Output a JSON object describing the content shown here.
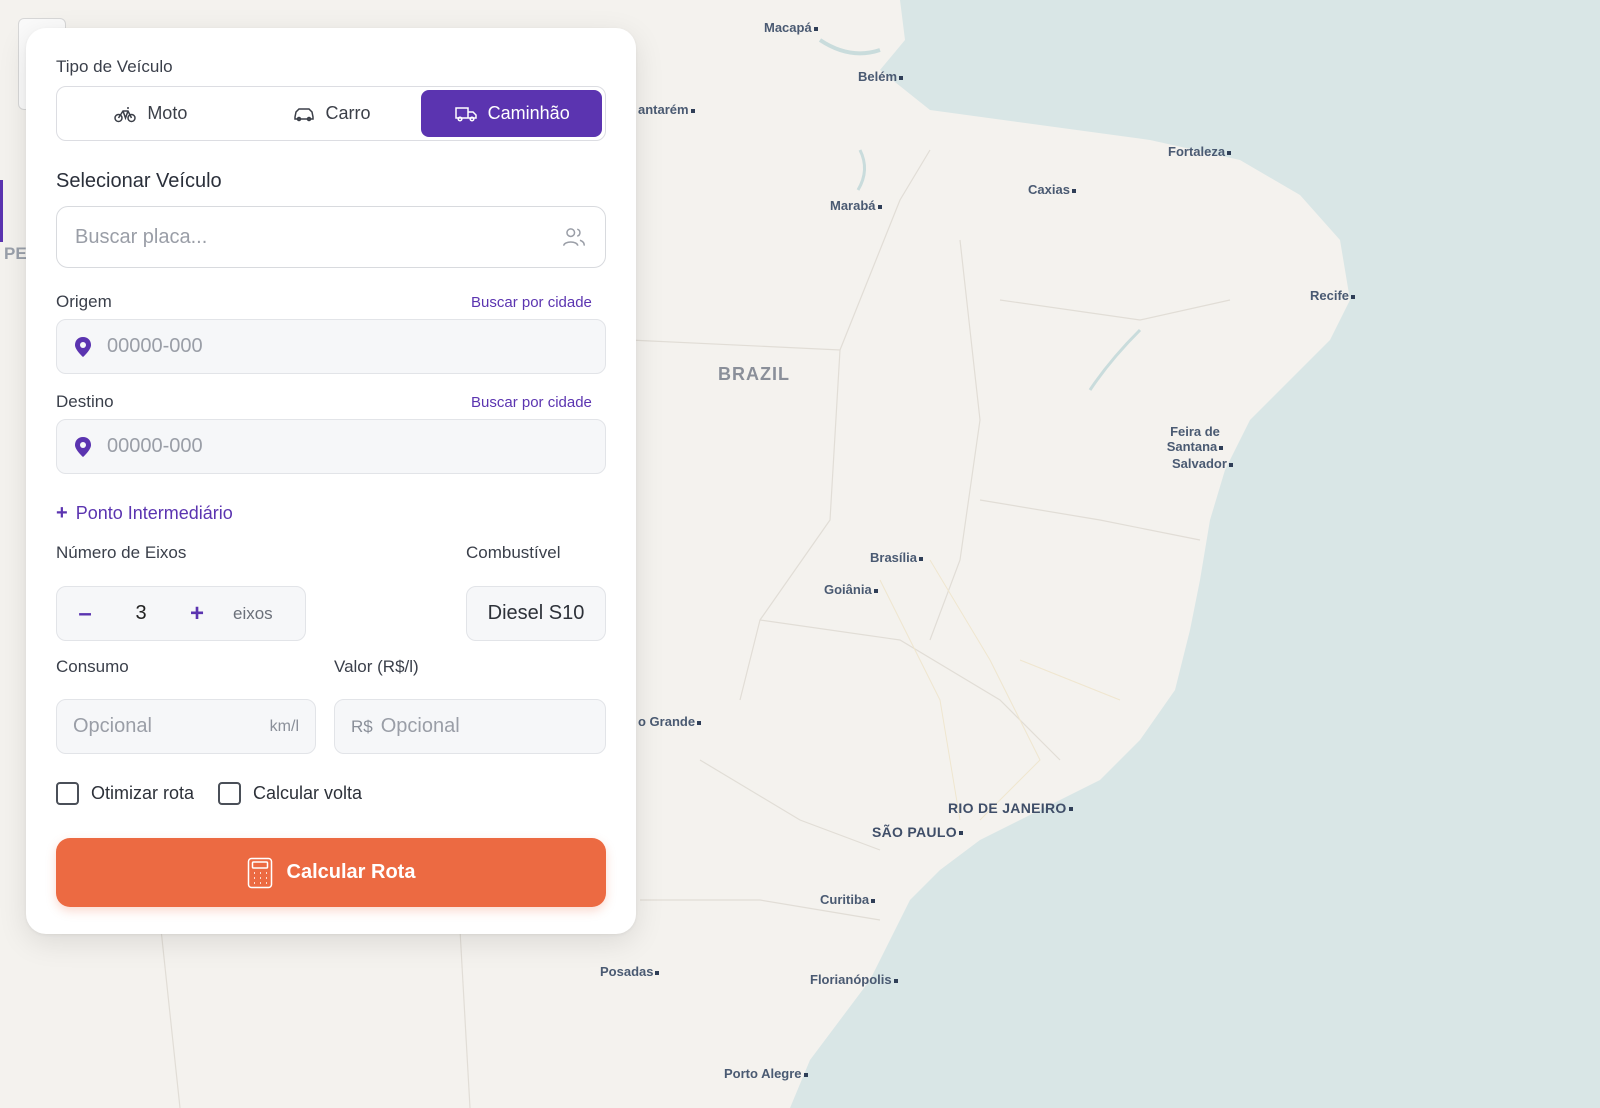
{
  "map": {
    "country_label": "BRAZIL",
    "left_edge_label": "PE",
    "cities": [
      {
        "name": "Macapá"
      },
      {
        "name": "Belém"
      },
      {
        "name": "antarém"
      },
      {
        "name": "Fortaleza"
      },
      {
        "name": "Caxias"
      },
      {
        "name": "Marabá"
      },
      {
        "name": "Recife"
      },
      {
        "name": "Feira de Santana"
      },
      {
        "name": "Salvador"
      },
      {
        "name": "Brasília"
      },
      {
        "name": "Goiânia"
      },
      {
        "name": "o Grande"
      },
      {
        "name": "RIO DE JANEIRO"
      },
      {
        "name": "SÃO PAULO"
      },
      {
        "name": "Curitiba"
      },
      {
        "name": "Posadas"
      },
      {
        "name": "Florianópolis"
      },
      {
        "name": "Porto Alegre"
      }
    ]
  },
  "panel": {
    "vehicle_type_label": "Tipo de Veículo",
    "vehicle_types": [
      {
        "label": "Moto",
        "icon": "bicycle-icon",
        "active": false
      },
      {
        "label": "Carro",
        "icon": "car-icon",
        "active": false
      },
      {
        "label": "Caminhão",
        "icon": "truck-icon",
        "active": true
      }
    ],
    "select_vehicle_label": "Selecionar Veículo",
    "plate_search_placeholder": "Buscar placa...",
    "origin": {
      "label": "Origem",
      "city_link": "Buscar por cidade",
      "placeholder": "00000-000"
    },
    "destination": {
      "label": "Destino",
      "city_link": "Buscar por cidade",
      "placeholder": "00000-000"
    },
    "add_waypoint": "Ponto Intermediário",
    "axles": {
      "label": "Número de Eixos",
      "decrement": "–",
      "value": "3",
      "increment": "+",
      "unit": "eixos"
    },
    "fuel": {
      "label": "Combustível",
      "selected": "Diesel S10"
    },
    "consumption": {
      "label": "Consumo",
      "placeholder": "Opcional",
      "suffix": "km/l"
    },
    "price": {
      "label": "Valor (R$/l)",
      "prefix": "R$",
      "placeholder": "Opcional"
    },
    "optimize_route": "Otimizar rota",
    "calculate_return": "Calcular volta",
    "calculate_button": "Calcular Rota"
  },
  "colors": {
    "accent": "#5b34b0",
    "cta": "#ec6a42",
    "ocean": "#d9e6e6",
    "land": "#f4f2ee"
  }
}
